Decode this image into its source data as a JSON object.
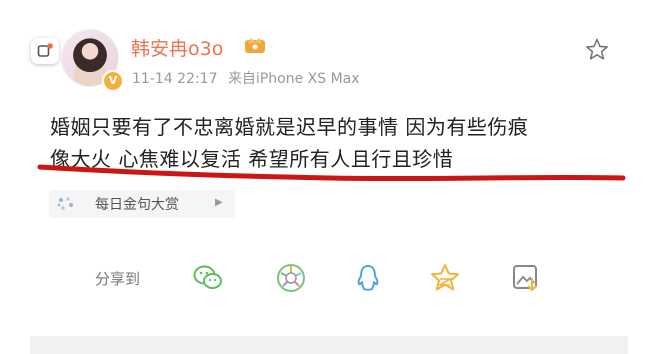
{
  "post": {
    "username": "韩安冉o3o",
    "time": "11-14 22:17",
    "source": "来自iPhone XS Max",
    "line1": "婚姻只要有了不忠离婚就是迟早的事情 因为有些伤痕",
    "line2": "像大火 心焦难以复活 希望所有人且行且珍惜"
  },
  "topic": {
    "label": "每日金句大赏"
  },
  "share": {
    "label": "分享到",
    "targets": [
      "wechat-icon",
      "moments-icon",
      "qq-icon",
      "qzone-icon",
      "save-image-icon"
    ]
  },
  "colors": {
    "username": "#eb7350",
    "underline": "#cc1515",
    "accent": "#f3b23c"
  }
}
